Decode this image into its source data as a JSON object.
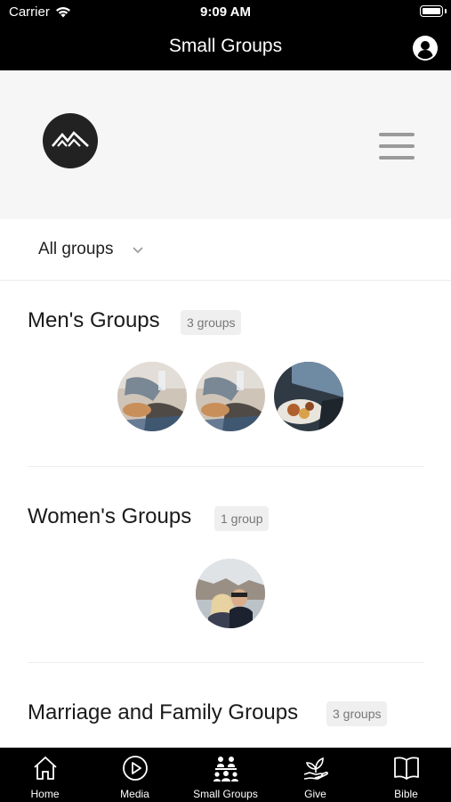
{
  "status_bar": {
    "carrier": "Carrier",
    "time": "9:09 AM"
  },
  "nav": {
    "title": "Small Groups",
    "account_icon": "account-icon"
  },
  "header": {
    "logo_icon": "mountain-logo-icon",
    "menu_icon": "hamburger-menu-icon"
  },
  "filter": {
    "label": "All groups",
    "icon": "chevron-down-icon"
  },
  "sections": [
    {
      "title": "Men's Groups",
      "count": "3 groups",
      "avatars": 3
    },
    {
      "title": "Women's Groups",
      "count": "1 group",
      "avatars": 1
    },
    {
      "title": "Marriage and Family Groups",
      "count": "3 groups"
    }
  ],
  "tabs": [
    {
      "label": "Home",
      "icon": "home-icon"
    },
    {
      "label": "Media",
      "icon": "play-icon"
    },
    {
      "label": "Small Groups",
      "icon": "groups-icon"
    },
    {
      "label": "Give",
      "icon": "give-hand-icon"
    },
    {
      "label": "Bible",
      "icon": "book-icon"
    }
  ],
  "colors": {
    "bar": "#000000",
    "header_bg": "#f6f6f6",
    "badge_bg": "#efefef",
    "text": "#1a1a1a"
  }
}
